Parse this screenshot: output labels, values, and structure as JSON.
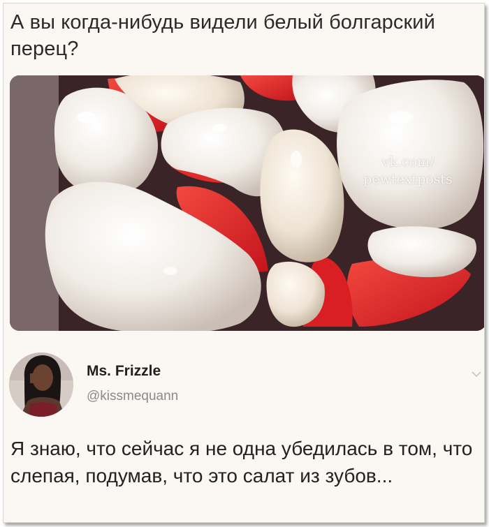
{
  "post": {
    "caption": "А вы когда-нибудь видели белый болгарский перец?",
    "watermark_line1": "vk.com/",
    "watermark_line2": "pewtextposts"
  },
  "tweet": {
    "display_name": "Ms. Frizzle",
    "handle": "@kissmequann",
    "text": "Я знаю, что сейчас я не одна убедилась в том, что слепая, подумав, что это салат из зубов..."
  },
  "colors": {
    "card_background": "#fbf8f4",
    "caption_text": "#2a2a2a",
    "handle_text": "#8a8a8a"
  },
  "icons": {
    "more_menu": "chevron-down-icon"
  }
}
